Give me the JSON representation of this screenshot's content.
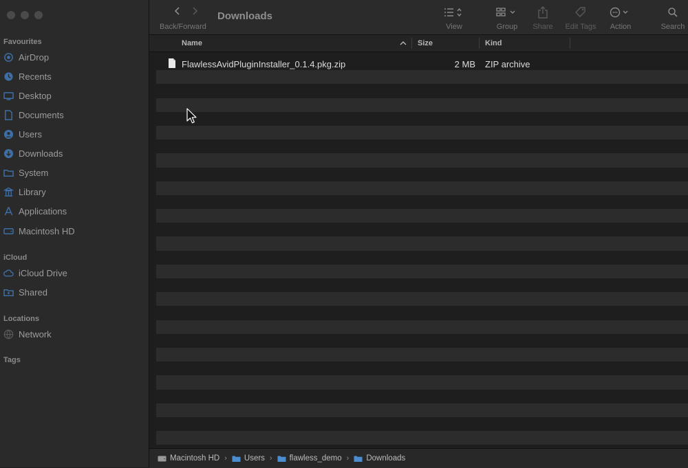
{
  "window": {
    "title": "Downloads"
  },
  "toolbar": {
    "nav_label": "Back/Forward",
    "view_label": "View",
    "group_label": "Group",
    "share_label": "Share",
    "edit_tags_label": "Edit Tags",
    "action_label": "Action",
    "search_label": "Search"
  },
  "sidebar": {
    "favourites_header": "Favourites",
    "favourites": [
      {
        "label": "AirDrop",
        "icon": "airdrop-icon"
      },
      {
        "label": "Recents",
        "icon": "clock-icon"
      },
      {
        "label": "Desktop",
        "icon": "desktop-icon"
      },
      {
        "label": "Documents",
        "icon": "document-icon"
      },
      {
        "label": "Users",
        "icon": "user-icon"
      },
      {
        "label": "Downloads",
        "icon": "download-icon"
      },
      {
        "label": "System",
        "icon": "folder-icon"
      },
      {
        "label": "Library",
        "icon": "library-icon"
      },
      {
        "label": "Applications",
        "icon": "applications-icon"
      },
      {
        "label": "Macintosh HD",
        "icon": "harddrive-icon"
      }
    ],
    "icloud_header": "iCloud",
    "icloud": [
      {
        "label": "iCloud Drive",
        "icon": "cloud-icon"
      },
      {
        "label": "Shared",
        "icon": "shared-folder-icon"
      }
    ],
    "locations_header": "Locations",
    "locations": [
      {
        "label": "Network",
        "icon": "globe-icon"
      }
    ],
    "tags_header": "Tags"
  },
  "columns": {
    "name": "Name",
    "size": "Size",
    "kind": "Kind"
  },
  "files": [
    {
      "name": "FlawlessAvidPluginInstaller_0.1.4.pkg.zip",
      "size": "2 MB",
      "kind": "ZIP archive"
    }
  ],
  "pathbar": [
    "Macintosh HD",
    "Users",
    "flawless_demo",
    "Downloads"
  ]
}
